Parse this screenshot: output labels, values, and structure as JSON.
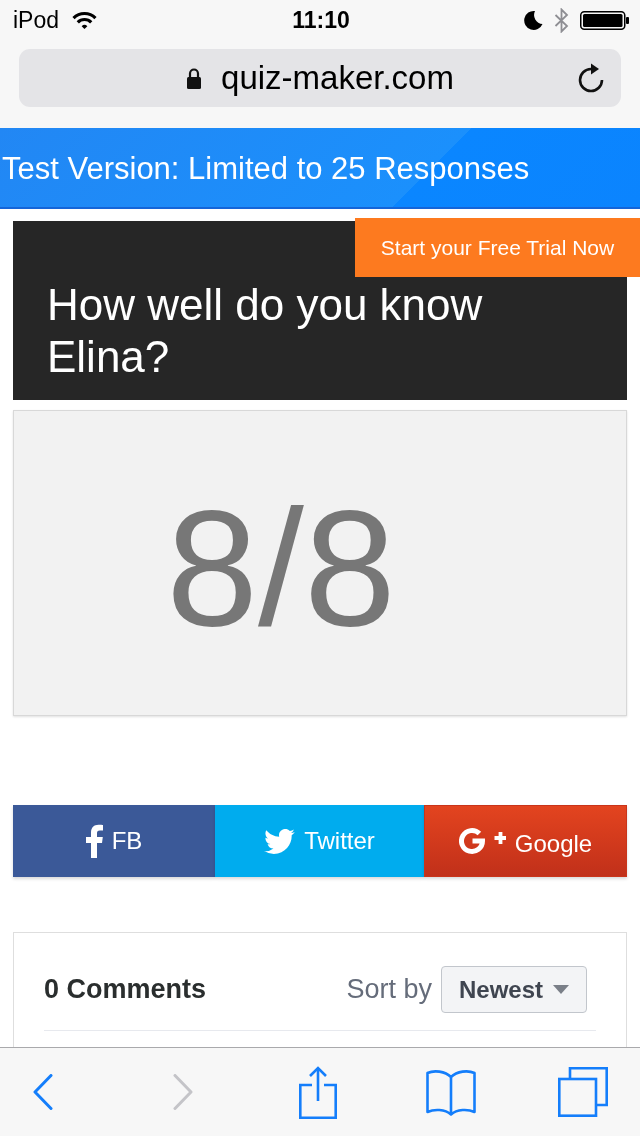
{
  "status_bar": {
    "carrier": "iPod",
    "time": "11:10"
  },
  "address_bar": {
    "url": "quiz-maker.com"
  },
  "banner": {
    "text": "Test Version: Limited to 25 Responses"
  },
  "quiz": {
    "title": "How well do you know Elina?",
    "trial_button": "Start your Free Trial Now",
    "score": "8/8"
  },
  "share_buttons": [
    {
      "kind": "facebook",
      "label": "FB"
    },
    {
      "kind": "twitter",
      "label": "Twitter"
    },
    {
      "kind": "google",
      "label": "Google"
    }
  ],
  "comments": {
    "count": "0 Comments",
    "sort_label": "Sort by",
    "sort_value": "Newest"
  },
  "toolbar": [
    {
      "kind": "back",
      "disabled": false
    },
    {
      "kind": "forward",
      "disabled": true
    },
    {
      "kind": "share",
      "disabled": false
    },
    {
      "kind": "bookmarks",
      "disabled": false
    },
    {
      "kind": "tabs",
      "disabled": false
    }
  ]
}
